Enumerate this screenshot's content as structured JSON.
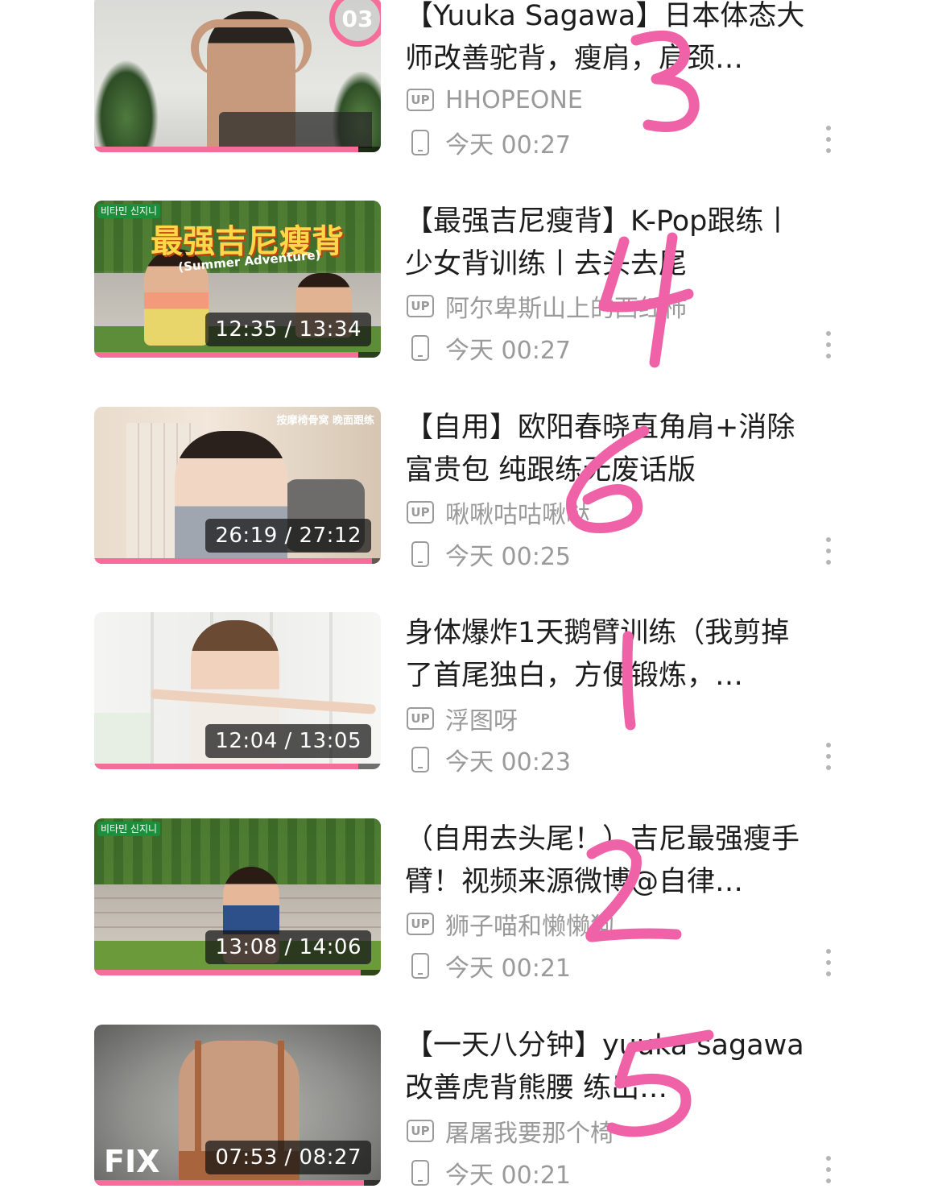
{
  "videos": [
    {
      "title": "【Yuuka Sagawa】日本体态大师改善驼背，瘦肩，肩颈…",
      "uploader": "HHOPEONE",
      "time": "今天 00:27",
      "duration": "",
      "badge": "03",
      "progress": 0.92,
      "annotation": "3"
    },
    {
      "title": "【最强吉尼瘦背】K-Pop跟练丨少女背训练丨去头去尾",
      "uploader": "阿尔卑斯山上的西红柿",
      "time": "今天 00:27",
      "duration": "12:35 / 13:34",
      "overlay_banner": "最强吉尼瘦背",
      "overlay_sub": "(Summer Adventure)",
      "overlay_corner": "비타민 신지니",
      "progress": 0.92,
      "annotation": "4"
    },
    {
      "title": "【自用】欧阳春晓直角肩+消除富贵包 纯跟练无废话版",
      "uploader": "啾啾咕咕啾哒",
      "time": "今天 00:25",
      "duration": "26:19 / 27:12",
      "overlay_caption": "按摩椅骨窝 晚面跟练",
      "progress": 0.97,
      "annotation": "6"
    },
    {
      "title": "身体爆炸1天鹅臂训练（我剪掉了首尾独白，方便锻炼，…",
      "uploader": "浮图呀",
      "time": "今天 00:23",
      "duration": "12:04 / 13:05",
      "progress": 0.92,
      "annotation": "1"
    },
    {
      "title": "（自用去头尾！）吉尼最强瘦手臂！视频来源微博@自律…",
      "uploader": "狮子喵和懒懒狗",
      "time": "今天 00:21",
      "duration": "13:08 / 14:06",
      "overlay_corner": "비타민 신지니",
      "progress": 0.93,
      "annotation": "2"
    },
    {
      "title": "【一天八分钟】yuuka sagawa 改善虎背熊腰 练出…",
      "uploader": "屠屠我要那个椅",
      "time": "今天 00:21",
      "duration": "07:53 / 08:27",
      "overlay_label": "FIX",
      "progress": 0.94,
      "annotation": "5"
    }
  ],
  "icons": {
    "uploader": "up-icon",
    "device": "phone-icon",
    "more": "more-vertical-icon"
  },
  "colors": {
    "accent": "#f46d9b",
    "annotation": "#f062a8",
    "meta_text": "#9a9a9a"
  }
}
